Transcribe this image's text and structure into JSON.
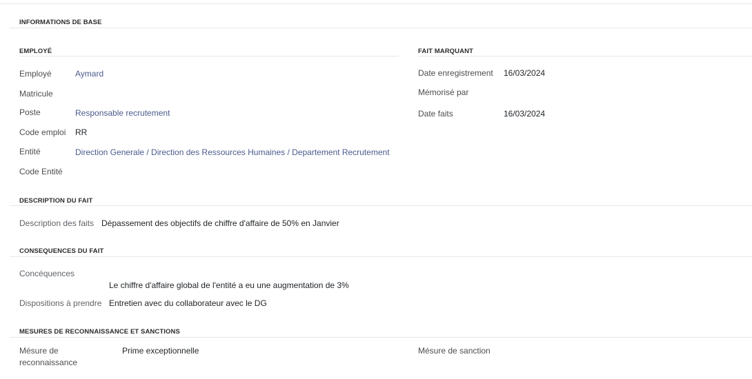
{
  "base": {
    "title": "INFORMATIONS DE BASE"
  },
  "employee": {
    "title": "EMPLOYÉ",
    "rows": [
      {
        "label": "Employé",
        "value": "Aymard"
      },
      {
        "label": "Matricule",
        "value": ""
      },
      {
        "label": "Poste",
        "value": "Responsable recrutement"
      },
      {
        "label": "Code emploi",
        "value": "RR"
      },
      {
        "label": "Entité",
        "value": "Direction Generale / Direction des Ressources Humaines / Departement Recrutement"
      },
      {
        "label": "Code Entité",
        "value": ""
      }
    ]
  },
  "fait_marquant": {
    "title": "FAIT MARQUANT",
    "rows": [
      {
        "label": "Date enregistrement",
        "value": "16/03/2024"
      },
      {
        "label": "Mémorisé par",
        "value": ""
      },
      {
        "label": "Date faits",
        "value": "16/03/2024"
      }
    ]
  },
  "description": {
    "title": "DESCRIPTION DU FAIT",
    "label": "Description des faits",
    "value": "Dépassement des objectifs de chiffre d'affaire de 50% en Janvier"
  },
  "consequences": {
    "title": "CONSEQUENCES DU FAIT",
    "label": "Concéquences",
    "value": "Le chiffre d'affaire global de l'entité a eu une augmentation de 3%",
    "dispositions_label": "Dispositions à prendre",
    "dispositions_value": "Entretien avec du collaborateur avec le DG"
  },
  "mesures": {
    "title": "MESURES DE RECONNAISSANCE ET SANCTIONS",
    "recon_label_1": "Mésure de",
    "recon_label_2": "reconnaissance",
    "recon_value": "Prime exceptionnelle",
    "sanction_label": "Mésure de sanction",
    "sanction_value": ""
  }
}
